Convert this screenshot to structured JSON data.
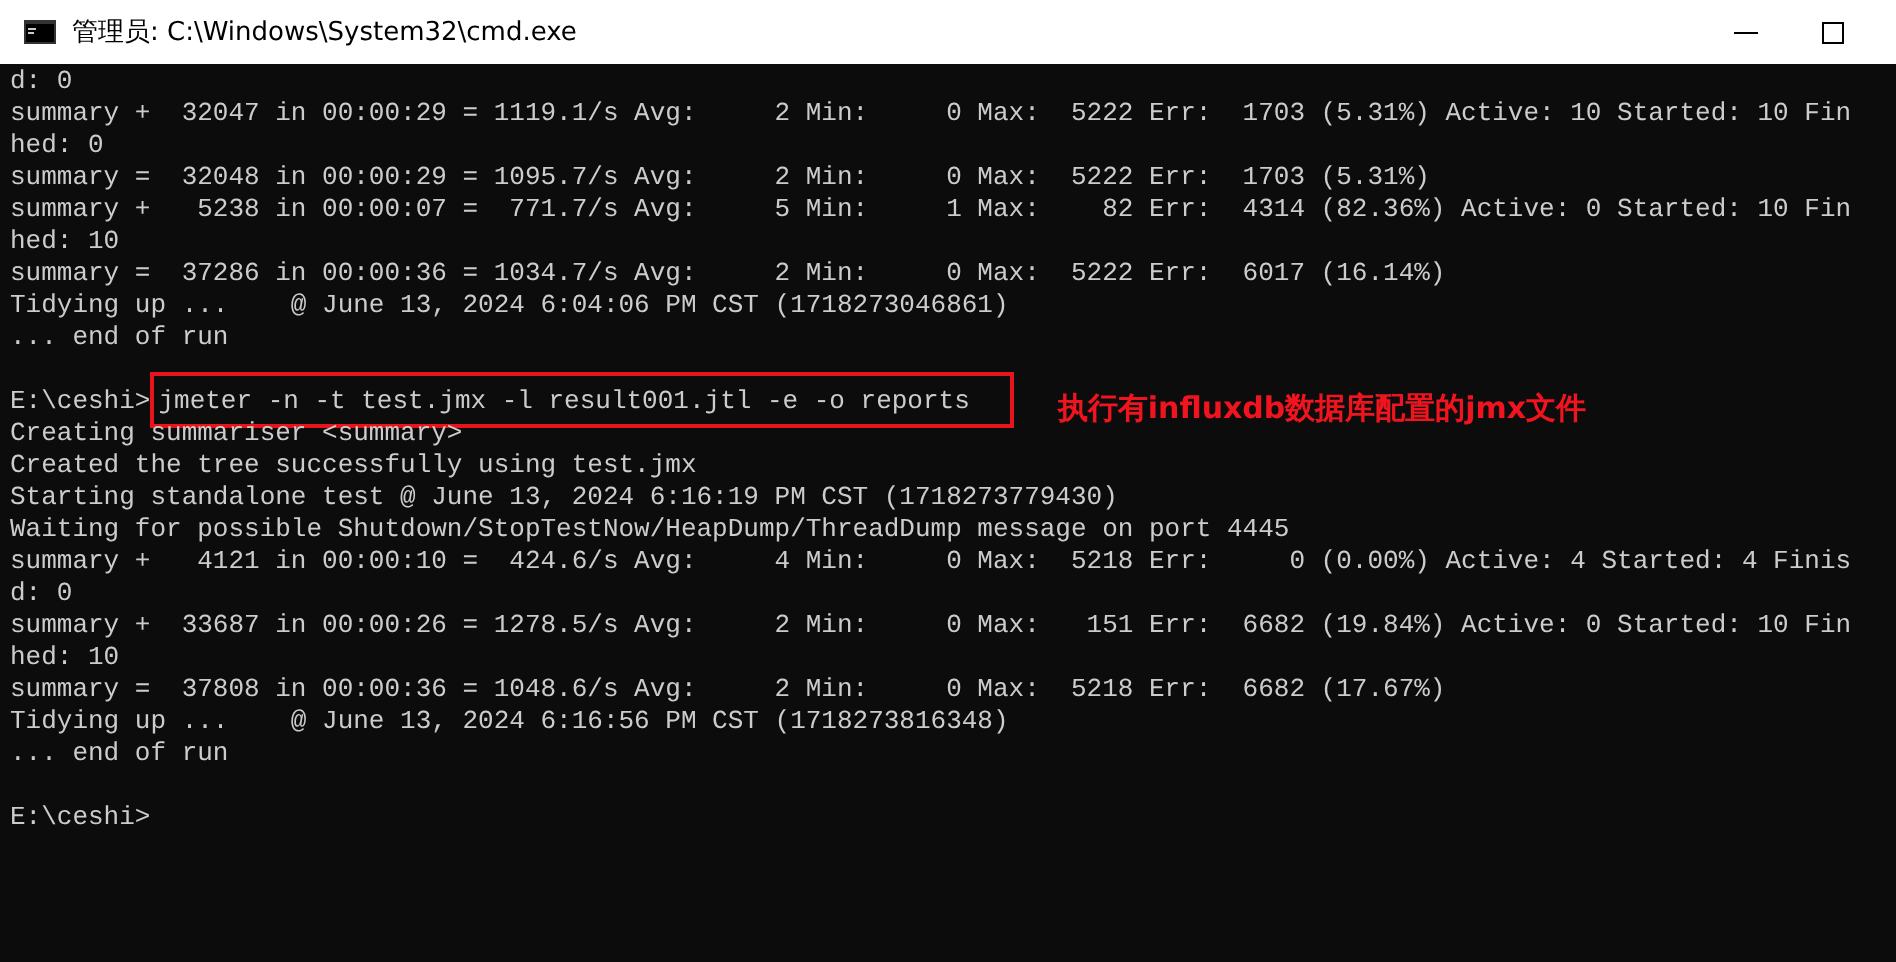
{
  "window": {
    "title": "管理员: C:\\Windows\\System32\\cmd.exe"
  },
  "lines": [
    {
      "kind": "output",
      "text": "d: 0"
    },
    {
      "kind": "output",
      "text": "summary +  32047 in 00:00:29 = 1119.1/s Avg:     2 Min:     0 Max:  5222 Err:  1703 (5.31%) Active: 10 Started: 10 Fin"
    },
    {
      "kind": "output",
      "text": "hed: 0"
    },
    {
      "kind": "output",
      "text": "summary =  32048 in 00:00:29 = 1095.7/s Avg:     2 Min:     0 Max:  5222 Err:  1703 (5.31%)"
    },
    {
      "kind": "output",
      "text": "summary +   5238 in 00:00:07 =  771.7/s Avg:     5 Min:     1 Max:    82 Err:  4314 (82.36%) Active: 0 Started: 10 Fin"
    },
    {
      "kind": "output",
      "text": "hed: 10"
    },
    {
      "kind": "output",
      "text": "summary =  37286 in 00:00:36 = 1034.7/s Avg:     2 Min:     0 Max:  5222 Err:  6017 (16.14%)"
    },
    {
      "kind": "output",
      "text": "Tidying up ...    @ June 13, 2024 6:04:06 PM CST (1718273046861)"
    },
    {
      "kind": "output",
      "text": "... end of run"
    },
    {
      "kind": "blank"
    },
    {
      "kind": "command",
      "prompt": "E:\\ceshi>",
      "command": "jmeter -n -t test.jmx -l result001.jtl -e -o reports",
      "highlighted": true,
      "annotation": "执行有influxdb数据库配置的jmx文件"
    },
    {
      "kind": "output",
      "text": "Creating summariser <summary>"
    },
    {
      "kind": "output",
      "text": "Created the tree successfully using test.jmx"
    },
    {
      "kind": "output",
      "text": "Starting standalone test @ June 13, 2024 6:16:19 PM CST (1718273779430)"
    },
    {
      "kind": "output",
      "text": "Waiting for possible Shutdown/StopTestNow/HeapDump/ThreadDump message on port 4445"
    },
    {
      "kind": "output",
      "text": "summary +   4121 in 00:00:10 =  424.6/s Avg:     4 Min:     0 Max:  5218 Err:     0 (0.00%) Active: 4 Started: 4 Finis"
    },
    {
      "kind": "output",
      "text": "d: 0"
    },
    {
      "kind": "output",
      "text": "summary +  33687 in 00:00:26 = 1278.5/s Avg:     2 Min:     0 Max:   151 Err:  6682 (19.84%) Active: 0 Started: 10 Fin"
    },
    {
      "kind": "output",
      "text": "hed: 10"
    },
    {
      "kind": "output",
      "text": "summary =  37808 in 00:00:36 = 1048.6/s Avg:     2 Min:     0 Max:  5218 Err:  6682 (17.67%)"
    },
    {
      "kind": "output",
      "text": "Tidying up ...    @ June 13, 2024 6:16:56 PM CST (1718273816348)"
    },
    {
      "kind": "output",
      "text": "... end of run"
    },
    {
      "kind": "blank"
    },
    {
      "kind": "prompt",
      "prompt": "E:\\ceshi>"
    }
  ]
}
